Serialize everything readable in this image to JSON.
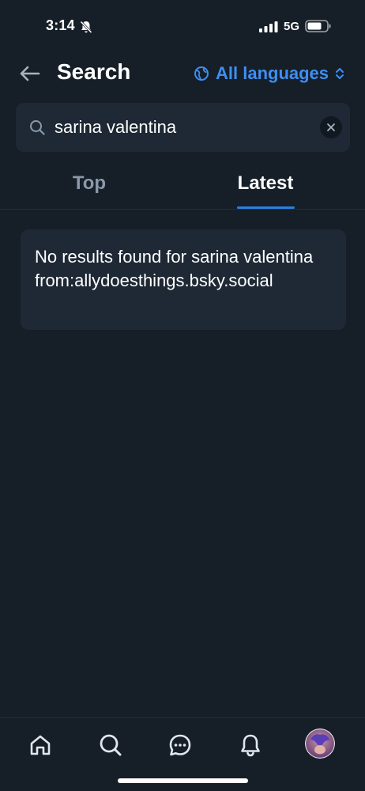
{
  "status_bar": {
    "time": "3:14",
    "network": "5G"
  },
  "header": {
    "title": "Search",
    "language_label": "All languages"
  },
  "search": {
    "value": "sarina valentina",
    "placeholder": ""
  },
  "tabs": [
    {
      "label": "Top",
      "selected": false
    },
    {
      "label": "Latest",
      "selected": true
    }
  ],
  "results": {
    "empty_message": "No results found for sarina valentina from:allydoesthings.bsky.social"
  },
  "bottom_nav": {
    "items": [
      "home-icon",
      "search-icon",
      "chat-icon",
      "bell-icon",
      "avatar"
    ]
  },
  "colors": {
    "background": "#161e27",
    "surface": "#1e2935",
    "accent": "#3d8ff2",
    "muted_text": "#8a99aa"
  }
}
